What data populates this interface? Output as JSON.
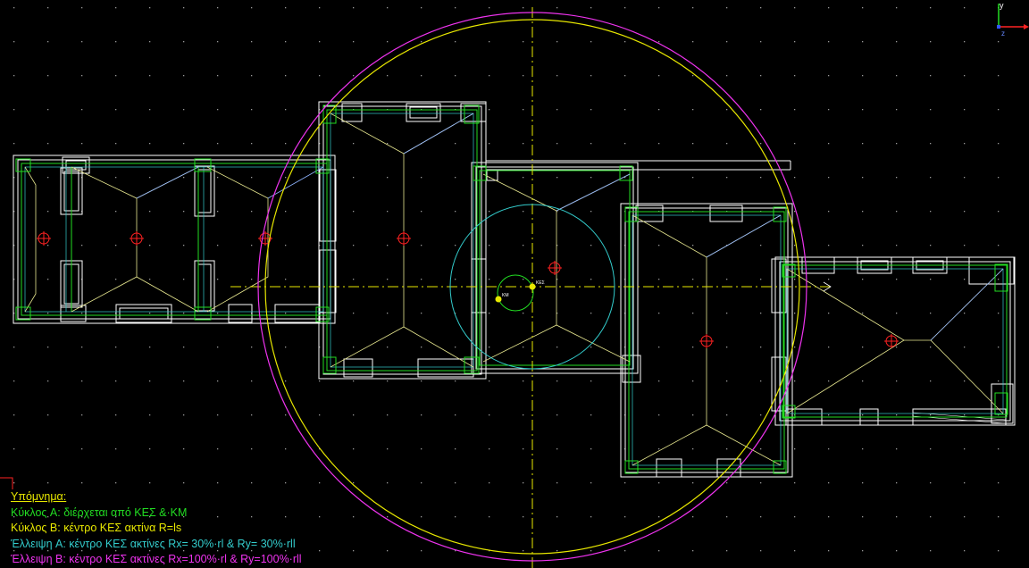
{
  "legend": {
    "title": "Υπόμνημα:",
    "items": [
      {
        "text": "Κύκλος  A: διέρχεται από ΚΕΣ &·KM",
        "color": "#22dd22"
      },
      {
        "text": "Κύκλος  B: κέντρο ΚΕΣ ακτίνα R=ls",
        "color": "#e8e800"
      },
      {
        "text": "Έλλειψη A: κέντρο ΚΕΣ ακτίνες Rx= 30%·rl & Ry= 30%·rll",
        "color": "#33cccc"
      },
      {
        "text": "Έλλειψη B: κέντρο ΚΕΣ ακτίνες Rx=100%·rl & Ry=100%·rll",
        "color": "#ee33ee"
      }
    ],
    "title_color": "#e8e800"
  },
  "drawing_labels": {
    "km": "KM",
    "kes": "ΚΕΣ"
  },
  "ucs": {
    "y_label": "y",
    "z_label": "z"
  },
  "colors": {
    "background": "#000000",
    "grid_dot": "#9a9a9a",
    "wall": "#ffffff",
    "beam_green": "#22dd22",
    "cyan": "#33cccc",
    "yellow": "#e8e800",
    "magenta": "#ee33ee",
    "slab_line": "#e8e890",
    "slab_line_blue": "#8fb4ff",
    "red_marker": "#ff2222"
  }
}
